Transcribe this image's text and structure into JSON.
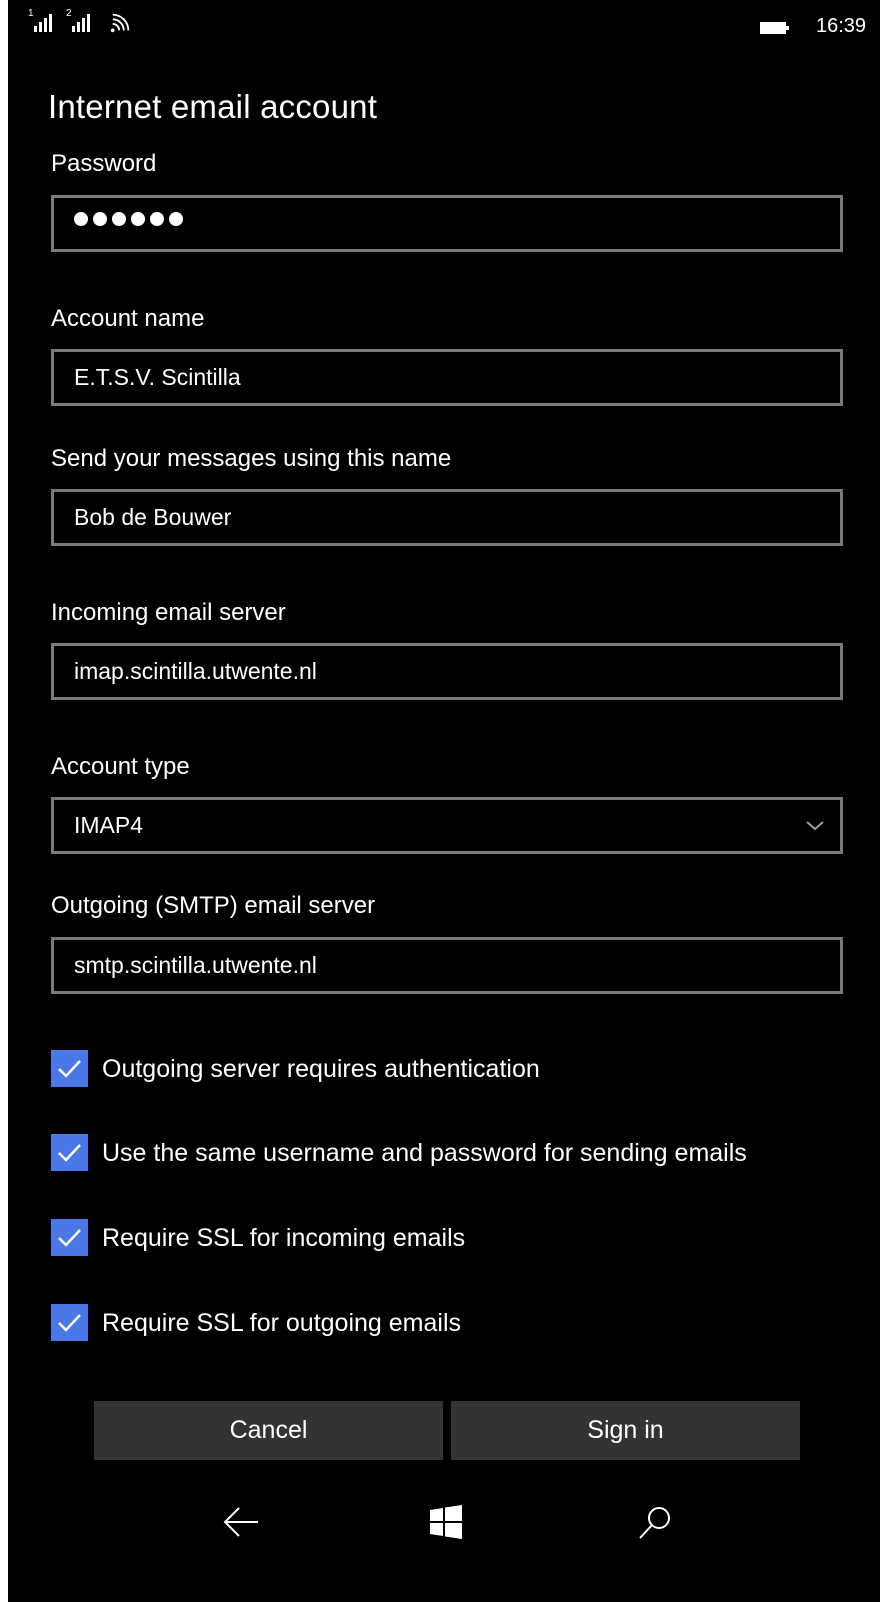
{
  "status_bar": {
    "sim1": "1",
    "sim2": "2",
    "time": "16:39"
  },
  "page": {
    "title": "Internet email account"
  },
  "fields": {
    "password": {
      "label": "Password",
      "masked_value": "••••••"
    },
    "account_name": {
      "label": "Account name",
      "value": "E.T.S.V. Scintilla"
    },
    "sender_name": {
      "label": "Send your messages using this name",
      "value": "Bob de Bouwer"
    },
    "incoming_server": {
      "label": "Incoming email server",
      "value": "imap.scintilla.utwente.nl"
    },
    "account_type": {
      "label": "Account type",
      "value": "IMAP4"
    },
    "outgoing_server": {
      "label": "Outgoing (SMTP) email server",
      "value": "smtp.scintilla.utwente.nl"
    }
  },
  "checkboxes": [
    {
      "label": "Outgoing server requires authentication",
      "checked": true
    },
    {
      "label": "Use the same username and password for sending emails",
      "checked": true
    },
    {
      "label": "Require SSL for incoming emails",
      "checked": true
    },
    {
      "label": "Require SSL for outgoing emails",
      "checked": true
    }
  ],
  "buttons": {
    "cancel": "Cancel",
    "sign_in": "Sign in"
  },
  "colors": {
    "accent": "#4a78e6",
    "background": "#000000",
    "field_border": "#7a7a7a",
    "button": "#333333"
  },
  "icons": {
    "back": "back-arrow-icon",
    "home": "windows-logo-icon",
    "search": "search-icon"
  }
}
